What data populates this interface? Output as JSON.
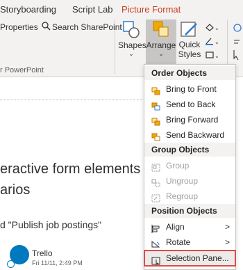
{
  "tabs": [
    {
      "label": "Storyboarding"
    },
    {
      "label": "Script Lab"
    },
    {
      "label": "Picture Format"
    }
  ],
  "ribbon": {
    "properties_label": "Properties",
    "search_sharepoint_label": "Search SharePoint",
    "group_label_fragment": "r PowerPoint",
    "shapes_label": "Shapes",
    "arrange_label": "Arrange",
    "quick_styles_label_1": "Quick",
    "quick_styles_label_2": "Styles"
  },
  "document": {
    "heading_line1": "eractive form elements",
    "heading_line2": "arios",
    "subtext": "d \"Publish job postings\"",
    "trello_name": "Trello",
    "trello_time": "Fri 11/11, 2:49 PM"
  },
  "menu": {
    "order_heading": "Order Objects",
    "bring_to_front": "Bring to Front",
    "send_to_back": "Send to Back",
    "bring_forward": "Bring Forward",
    "send_backward": "Send Backward",
    "group_heading": "Group Objects",
    "group": "Group",
    "ungroup": "Ungroup",
    "regroup": "Regroup",
    "position_heading": "Position Objects",
    "align": "Align",
    "rotate": "Rotate",
    "selection_pane": "Selection Pane..."
  },
  "colors": {
    "accent": "#c43e1c",
    "highlight_border": "#e04a4a",
    "trello_blue": "#0079bf",
    "menu_icon_orange": "#f2a900",
    "menu_icon_blue": "#2b7cd3"
  }
}
